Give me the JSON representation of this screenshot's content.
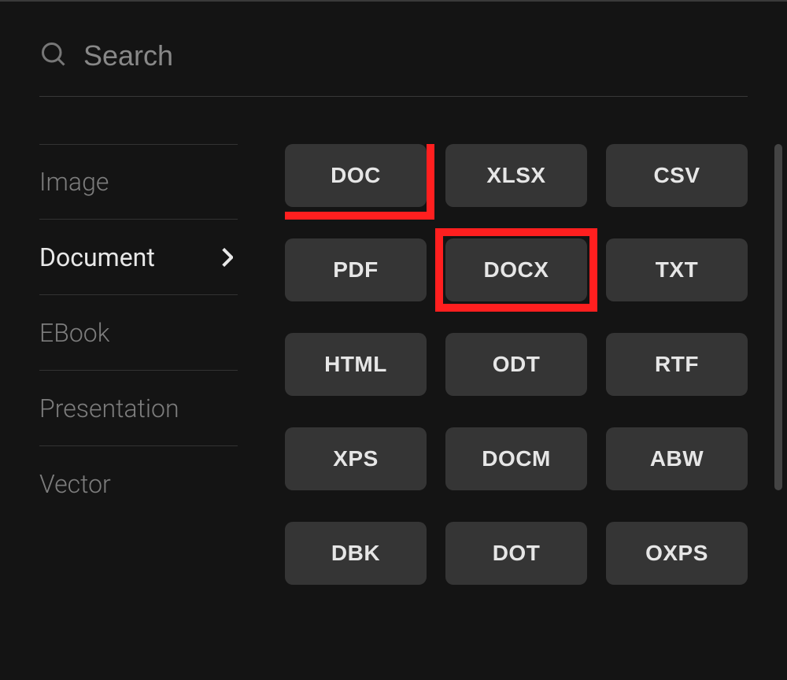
{
  "search": {
    "placeholder": "Search"
  },
  "sidebar": {
    "items": [
      {
        "label": "Image",
        "active": false
      },
      {
        "label": "Document",
        "active": true
      },
      {
        "label": "EBook",
        "active": false
      },
      {
        "label": "Presentation",
        "active": false
      },
      {
        "label": "Vector",
        "active": false
      }
    ]
  },
  "formats": [
    "DOC",
    "XLSX",
    "CSV",
    "PDF",
    "DOCX",
    "TXT",
    "HTML",
    "ODT",
    "RTF",
    "XPS",
    "DOCM",
    "ABW",
    "DBK",
    "DOT",
    "OXPS"
  ],
  "highlights": [
    "DOC",
    "DOCX"
  ]
}
